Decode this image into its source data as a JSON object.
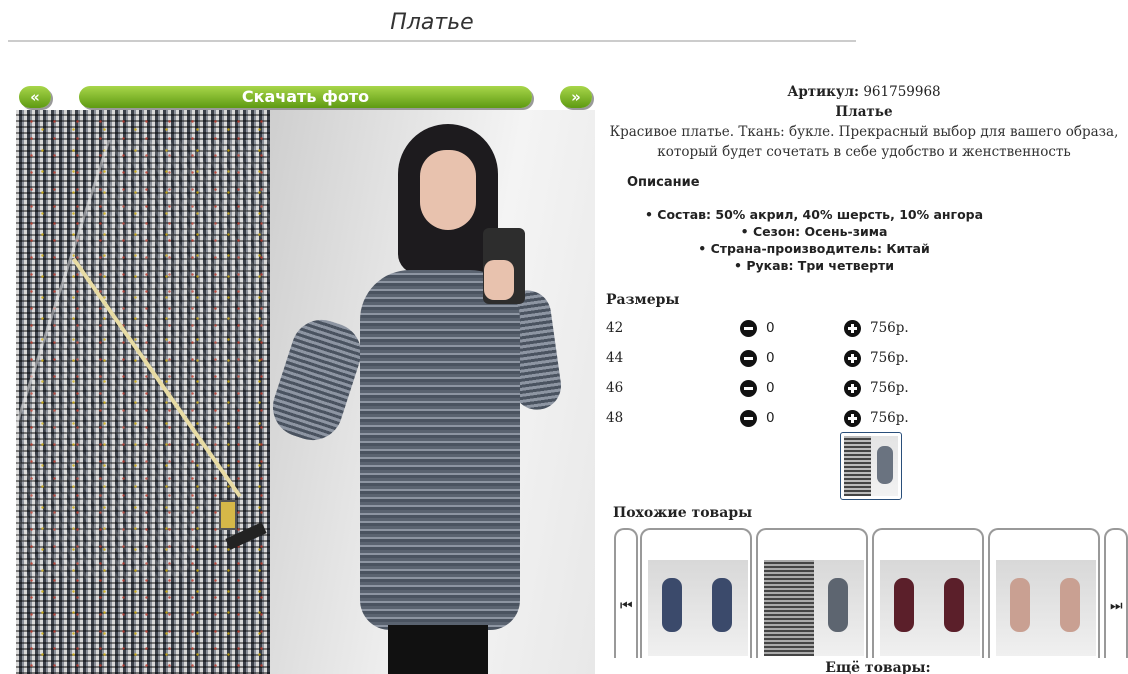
{
  "page": {
    "title": "Платье"
  },
  "gallery": {
    "prev_label": "«",
    "next_label": "»",
    "download_label": "Скачать фото"
  },
  "product": {
    "article_label": "Артикул:",
    "article_value": "961759968",
    "name": "Платье",
    "description": "Красивое платье. Ткань: букле. Прекрасный выбор для вашего образа, который будет сочетать в себе удобство и женственность",
    "description_heading": "Описание",
    "features": [
      "Состав: 50% акрил, 40% шерсть, 10% ангора",
      "Сезон: Осень-зима",
      "Страна-производитель: Китай",
      "Рукав: Три четверти"
    ]
  },
  "sizes": {
    "heading": "Размеры",
    "rows": [
      {
        "size": "42",
        "qty": "0",
        "price": "756р."
      },
      {
        "size": "44",
        "qty": "0",
        "price": "756р."
      },
      {
        "size": "46",
        "qty": "0",
        "price": "756р."
      },
      {
        "size": "48",
        "qty": "0",
        "price": "756р."
      }
    ]
  },
  "similar": {
    "heading": "Похожие товары",
    "prev_icon": "⏮",
    "next_icon": "⏭",
    "more_label": "Ещё товары:"
  },
  "colors": {
    "button_green_top": "#a8d64a",
    "button_green_bottom": "#5e9a12",
    "thumb_border": "#2a4f7a"
  },
  "icons": {
    "minus": "minus-circle-icon",
    "plus": "plus-circle-icon"
  }
}
